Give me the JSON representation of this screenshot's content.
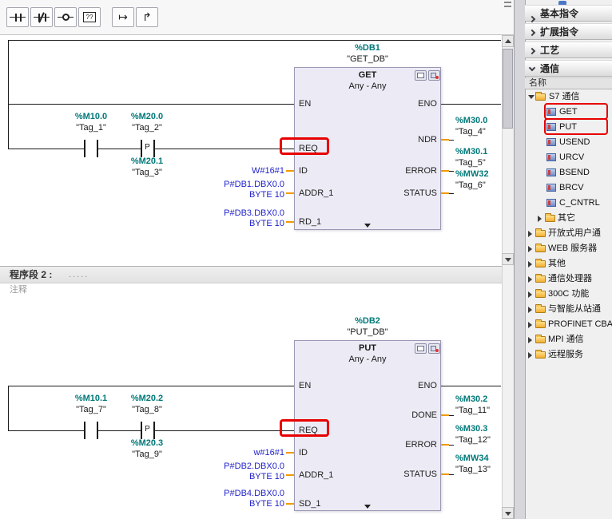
{
  "toolbar": {
    "buttons": [
      {
        "name": "no-contact-button"
      },
      {
        "name": "nc-contact-button"
      },
      {
        "name": "coil-button"
      },
      {
        "name": "empty-box-button",
        "glyph": "??"
      },
      {
        "name": "open-branch-button",
        "glyph": "↦"
      },
      {
        "name": "close-branch-button",
        "glyph": "↱"
      }
    ]
  },
  "networks": {
    "net1": {
      "db": "%DB1",
      "db_name": "\"GET_DB\"",
      "title": "GET",
      "types": "Any - Any",
      "pins_left": [
        "EN",
        "REQ",
        "ID",
        "ADDR_1",
        "RD_1"
      ],
      "pins_right": [
        "ENO",
        "NDR",
        "ERROR",
        "STATUS"
      ],
      "contact1": {
        "op": "%M10.0",
        "tag": "\"Tag_1\""
      },
      "contact2": {
        "op": "%M20.0",
        "tag": "\"Tag_2\"",
        "edge": "P",
        "edge_op": "%M20.1",
        "edge_tag": "\"Tag_3\""
      },
      "id_value": "W#16#1",
      "addr1_value": [
        "P#DB1.DBX0.0",
        "BYTE 10"
      ],
      "rd1_value": [
        "P#DB3.DBX0.0",
        "BYTE 10"
      ],
      "outputs": [
        {
          "op": "%M30.0",
          "tag": "\"Tag_4\""
        },
        {
          "op": "%M30.1",
          "tag": "\"Tag_5\""
        },
        {
          "op": "%MW32",
          "tag": "\"Tag_6\""
        }
      ]
    },
    "net2": {
      "db": "%DB2",
      "db_name": "\"PUT_DB\"",
      "title": "PUT",
      "types": "Any - Any",
      "pins_left": [
        "EN",
        "REQ",
        "ID",
        "ADDR_1",
        "SD_1"
      ],
      "pins_right": [
        "ENO",
        "DONE",
        "ERROR",
        "STATUS"
      ],
      "contact1": {
        "op": "%M10.1",
        "tag": "\"Tag_7\""
      },
      "contact2": {
        "op": "%M20.2",
        "tag": "\"Tag_8\"",
        "edge": "P",
        "edge_op": "%M20.3",
        "edge_tag": "\"Tag_9\""
      },
      "id_value": "w#16#1",
      "addr1_value": [
        "P#DB2.DBX0.0",
        "BYTE 10"
      ],
      "sd1_value": [
        "P#DB4.DBX0.0",
        "BYTE 10"
      ],
      "outputs": [
        {
          "op": "%M30.2",
          "tag": "\"Tag_11\""
        },
        {
          "op": "%M30.3",
          "tag": "\"Tag_12\""
        },
        {
          "op": "%MW34",
          "tag": "\"Tag_13\""
        }
      ]
    }
  },
  "network2_header": {
    "title": "程序段 2 :",
    "placeholder": ".....",
    "comment": "注释"
  },
  "sidebar": {
    "sections": [
      {
        "label": "基本指令"
      },
      {
        "label": "扩展指令"
      },
      {
        "label": "工艺"
      },
      {
        "label": "通信"
      }
    ],
    "name_header": "名称",
    "tree": {
      "group": "S7 通信",
      "instructions": [
        "GET",
        "PUT",
        "USEND",
        "URCV",
        "BSEND",
        "BRCV",
        "C_CNTRL"
      ],
      "subfolder": "其它",
      "folders": [
        "开放式用户通",
        "WEB 服务器",
        "其他",
        "通信处理器",
        "300C 功能",
        "与智能从站通",
        "PROFINET CBA",
        "MPI 通信",
        "远程服务"
      ]
    }
  },
  "colors": {
    "operand": "#007878",
    "constant": "#2323cc",
    "pin_stub": "#f09a00",
    "highlight": "#e80000"
  }
}
